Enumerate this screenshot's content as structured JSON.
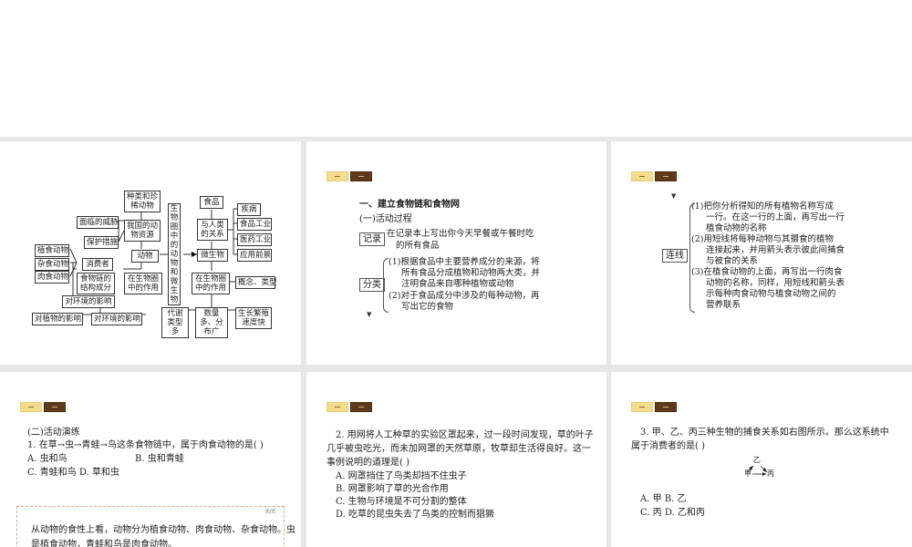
{
  "slide1": {
    "center_title": "生物圈中的动物和微生物",
    "animals": "动物",
    "microbes": "微生物",
    "species": "种类和珍稀动物",
    "threats": "面临的威胁",
    "resources": "我国的动物资源",
    "protection": "保护措施",
    "herbivore": "植食动物",
    "omnivore": "杂食动物",
    "carnivore": "肉食动物",
    "consumer": "消费者",
    "foodchain_struct": "食物链的结构成分",
    "role_in_bio": "在生物圈中的作用",
    "env_impact": "对环境的影响",
    "plant_impact": "对植物的影响",
    "env_impact2": "对环境的影响",
    "food": "食品",
    "human_relation": "与人类的关系",
    "disease": "疾病",
    "food_industry": "食品工业",
    "medicine": "医药工业",
    "prospect": "应用前景",
    "micro_role": "在生物圈中的作用",
    "concept": "概念、类型",
    "metabolism": "代谢类型多",
    "distribution": "数量多、分布广",
    "growth": "生长繁殖速度快"
  },
  "slide2": {
    "heading": "一、建立食物链和食物网",
    "sub": "(一)活动过程",
    "record_label": "记录",
    "record_l1": "在记录本上写出你今天早餐或午餐时吃",
    "record_l2": "的所有食品",
    "classify_label": "分类",
    "c1": "(1)根据食品中主要营养成分的来源，将",
    "c2": "所有食品分成植物和动物两大类，并",
    "c3": "注明食品来自哪种植物或动物",
    "c4": "(2)对于食品成分中涉及的每种动物，再",
    "c5": "写出它的食物"
  },
  "slide3": {
    "link_label": "连线",
    "l1": "(1)把你分析得知的所有植物名称写成",
    "l2": "一行。在这一行的上面，再写出一行",
    "l3": "植食动物的名称",
    "l4": "(2)用短线将每种动物与其摄食的植物",
    "l5": "连接起来，并用箭头表示彼此间捕食",
    "l6": "与被食的关系",
    "l7": "(3)在植食动物的上面，再写出一行肉食",
    "l8": "动物的名称，同样，用短线和箭头表",
    "l9": "示每种肉食动物与植食动物之间的",
    "l10": "营养联系"
  },
  "slide4": {
    "section": "(二)活动演练",
    "q1": "1. 在草→虫→青蛙→鸟这条食物链中，属于肉食动物的是(   )",
    "a": "A. 虫和鸟",
    "b": "B. 虫和青蛙",
    "cd": "C. 青蛙和鸟   D. 草和虫",
    "close": "关闭",
    "exp1": "从动物的食性上看，动物分为植食动物、肉食动物、杂食动物。虫",
    "exp2": "是植食动物，青蛙和鸟是肉食动物。"
  },
  "slide5": {
    "q1": "2. 用网将人工种草的实验区罩起来，过一段时间发现，草的叶子",
    "q2": "几乎被虫吃光，而未加网罩的天然草原，牧草却生活得良好。这一",
    "q3": "事例说明的道理是(   )",
    "a": "A. 网罩挡住了鸟类却挡不住虫子",
    "b": "B. 网罩影响了草的光合作用",
    "c": "C. 生物与环境是不可分割的整体",
    "d": "D. 吃草的昆虫失去了鸟类的控制而猖獗"
  },
  "slide6": {
    "q1": "3. 甲、乙、丙三种生物的捕食关系如右图所示。那么这系统中",
    "q2": "属于消费者的是(   )",
    "yi": "乙",
    "jia": "甲",
    "bing": "丙",
    "ab": "A. 甲   B. 乙",
    "cd": "C. 丙   D. 乙和丙"
  }
}
